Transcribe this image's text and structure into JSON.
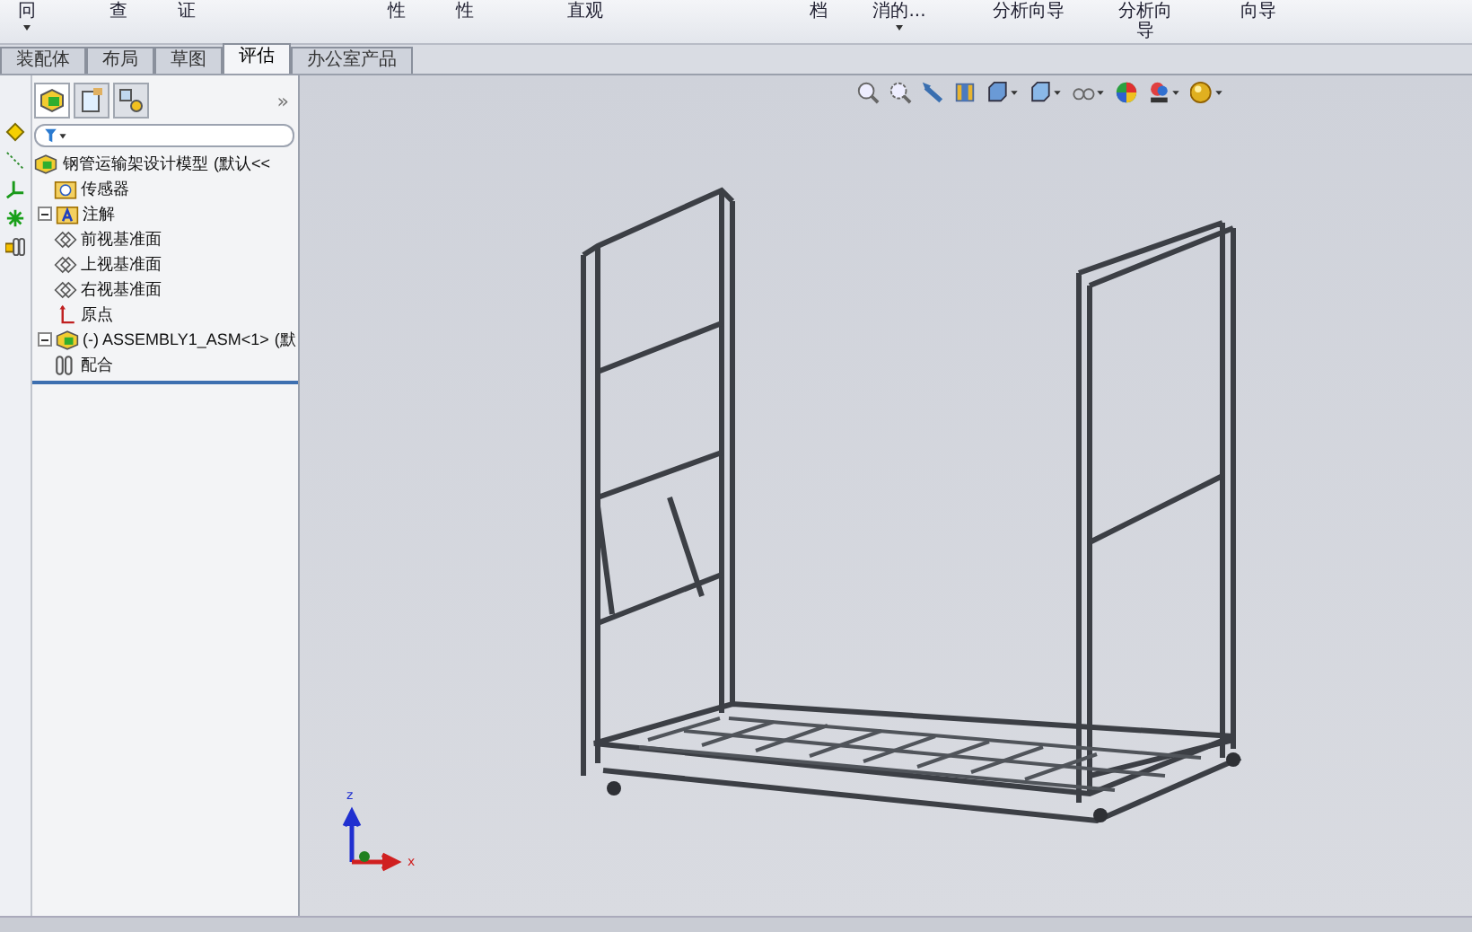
{
  "ribbon": [
    {
      "lines": [
        "冋"
      ],
      "caret": true
    },
    {
      "lines": [
        "查"
      ],
      "caret": false
    },
    {
      "lines": [
        "证"
      ],
      "caret": false
    },
    {
      "lines": [
        "性"
      ],
      "caret": false
    },
    {
      "lines": [
        "性"
      ],
      "caret": false
    },
    {
      "lines": [
        "直观"
      ],
      "caret": false
    },
    {
      "lines": [
        "档"
      ],
      "caret": false
    },
    {
      "lines": [
        "消的..."
      ],
      "caret": true
    },
    {
      "lines": [
        "分析向导"
      ],
      "caret": false
    },
    {
      "lines": [
        "分析向",
        "导"
      ],
      "caret": false
    },
    {
      "lines": [
        "向导"
      ],
      "caret": false
    }
  ],
  "tabs": [
    {
      "label": "装配体",
      "selected": false
    },
    {
      "label": "布局",
      "selected": false
    },
    {
      "label": "草图",
      "selected": false
    },
    {
      "label": "评估",
      "selected": true
    },
    {
      "label": "办公室产品",
      "selected": false
    }
  ],
  "tree": {
    "label": "钢管运输架设计模型",
    "suffix": "(默认<<",
    "children": [
      {
        "kind": "sensor",
        "label": "传感器",
        "expandable": false
      },
      {
        "kind": "annotation",
        "label": "注解",
        "expandable": true
      },
      {
        "kind": "plane",
        "label": "前视基准面",
        "expandable": false
      },
      {
        "kind": "plane",
        "label": "上视基准面",
        "expandable": false
      },
      {
        "kind": "plane",
        "label": "右视基准面",
        "expandable": false
      },
      {
        "kind": "origin",
        "label": "原点",
        "expandable": false
      },
      {
        "kind": "assembly",
        "label": "(-) ASSEMBLY1_ASM<1>",
        "suffix": "(默",
        "expandable": true
      },
      {
        "kind": "mate",
        "label": "配合",
        "expandable": false
      }
    ]
  },
  "panel_collapse": "»",
  "axis_labels": [
    "z",
    "x"
  ]
}
